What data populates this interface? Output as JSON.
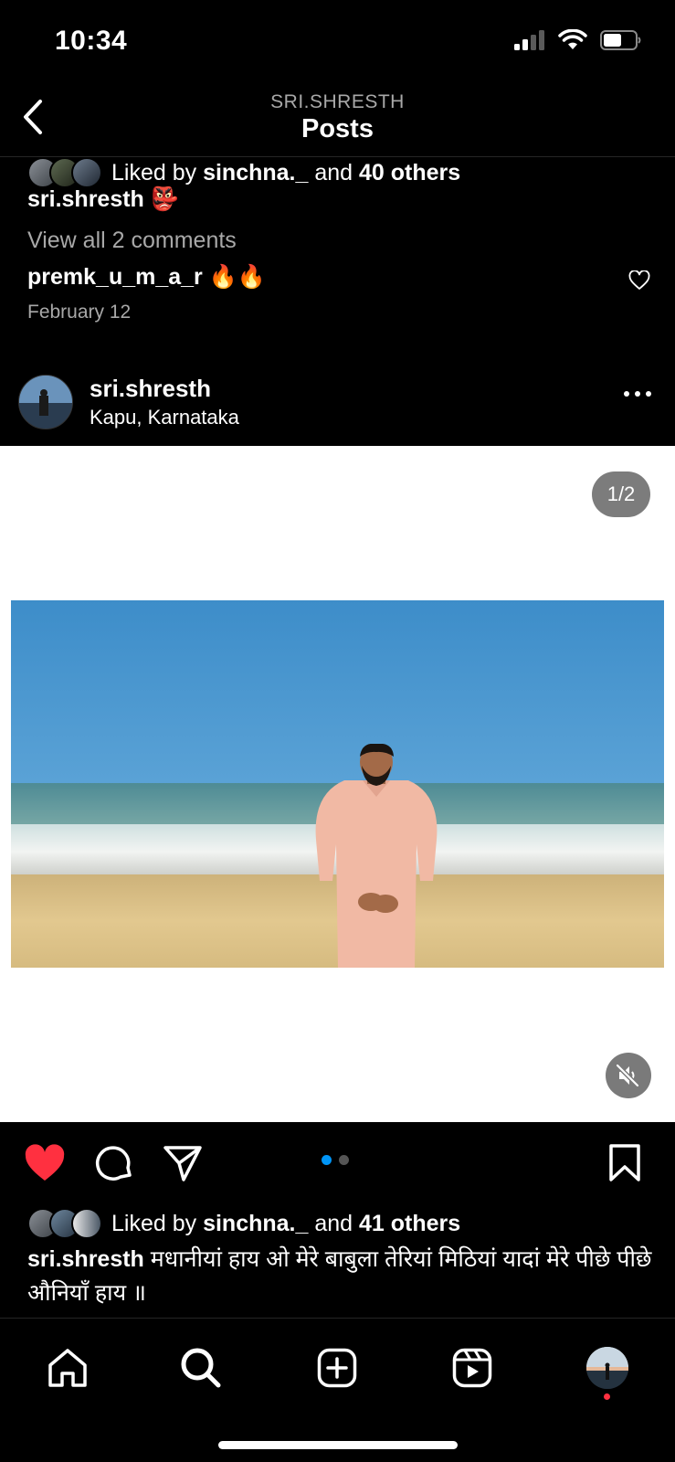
{
  "status_bar": {
    "time": "10:34"
  },
  "header": {
    "username_caps": "SRI.SHRESTH",
    "title": "Posts"
  },
  "previous_post": {
    "likes": {
      "prefix": "Liked by",
      "user": "sinchna._",
      "middle": "and",
      "others": "40 others"
    },
    "caption_user": "sri.shresth",
    "caption_emoji": "👺",
    "view_comments": "View all 2 comments",
    "comment_user": "premk_u_m_a_r",
    "comment_text": "🔥🔥",
    "date": "February 12"
  },
  "post": {
    "username": "sri.shresth",
    "location": "Kapu, Karnataka",
    "image_counter": "1/2",
    "carousel": {
      "count": 2,
      "active": 1
    },
    "liked": true,
    "likes": {
      "prefix": "Liked by",
      "user": "sinchna._",
      "middle": "and",
      "others": "41 others"
    },
    "caption_user": "sri.shresth",
    "caption_text": "मधानीयां हाय ओ मेरे बाबुला तेरियां मिठियां यादां मेरे पीछे पीछे औनियाँ हाय ॥"
  },
  "nav": {
    "items": [
      "home-icon",
      "search-icon",
      "create-icon",
      "reels-icon",
      "profile-avatar"
    ]
  },
  "colors": {
    "like_red": "#ff3040",
    "accent_blue": "#0095f6",
    "background": "#000000"
  }
}
